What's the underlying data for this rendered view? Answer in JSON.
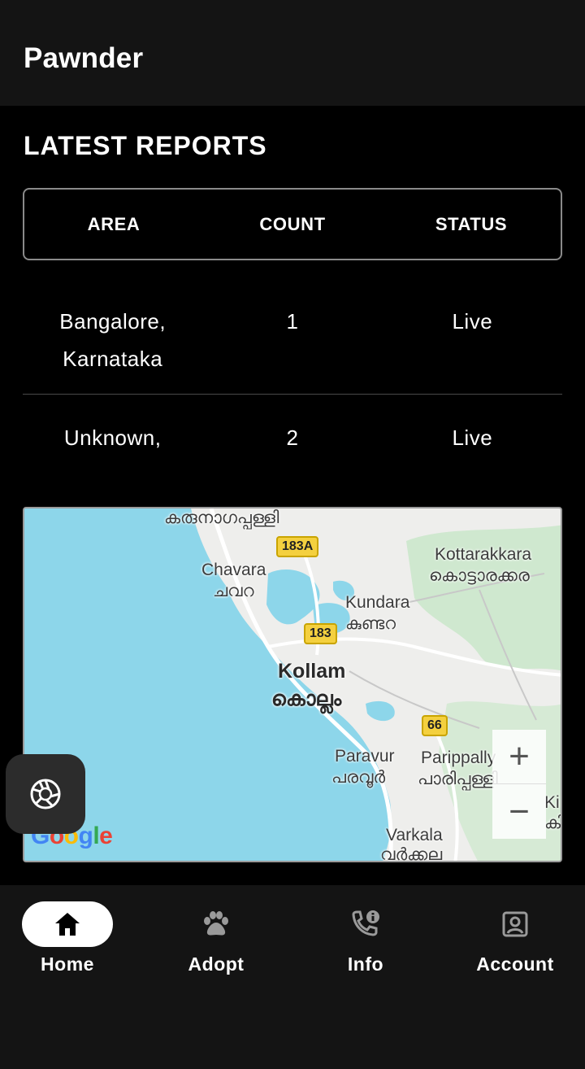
{
  "app": {
    "title": "Pawnder"
  },
  "reports": {
    "heading": "LATEST REPORTS",
    "columns": [
      "AREA",
      "COUNT",
      "STATUS"
    ],
    "rows": [
      {
        "area_line1": "Bangalore,",
        "area_line2": "Karnataka",
        "count": "1",
        "status": "Live"
      },
      {
        "area_line1": "Unknown,",
        "area_line2": "",
        "count": "2",
        "status": "Live"
      }
    ]
  },
  "map": {
    "labels": {
      "karunagappally_ml": "കരുനാഗപ്പള്ളി",
      "chavara": "Chavara",
      "chavara_ml": "ചവറ",
      "kottarakkara": "Kottarakkara",
      "kottarakkara_ml": "കൊട്ടാരക്കര",
      "kundara": "Kundara",
      "kundara_ml": "കുണ്ടറ",
      "kollam": "Kollam",
      "kollam_ml": "കൊല്ലം",
      "paravur": "Paravur",
      "paravur_ml": "പരവൂർ",
      "parippally": "Parippally",
      "parippally_ml": "പാരിപ്പള്ളി",
      "varkala": "Varkala",
      "varkala_ml": "വർക്കല",
      "ki": "Ki",
      "ki_ml": "കി"
    },
    "road_shields": {
      "r183a": "183A",
      "r183": "183",
      "r66": "66"
    },
    "zoom_in": "+",
    "zoom_out": "−",
    "attribution": "Google",
    "colors": {
      "water": "#8dd6ea",
      "land": "#eeeeec",
      "green": "#cfe8cf",
      "road": "#ffffff"
    }
  },
  "fab": {
    "icon": "camera-shutter-icon"
  },
  "nav": {
    "items": [
      {
        "label": "Home",
        "icon": "home-icon",
        "active": true
      },
      {
        "label": "Adopt",
        "icon": "paw-icon",
        "active": false
      },
      {
        "label": "Info",
        "icon": "phone-info-icon",
        "active": false
      },
      {
        "label": "Account",
        "icon": "account-box-icon",
        "active": false
      }
    ]
  }
}
